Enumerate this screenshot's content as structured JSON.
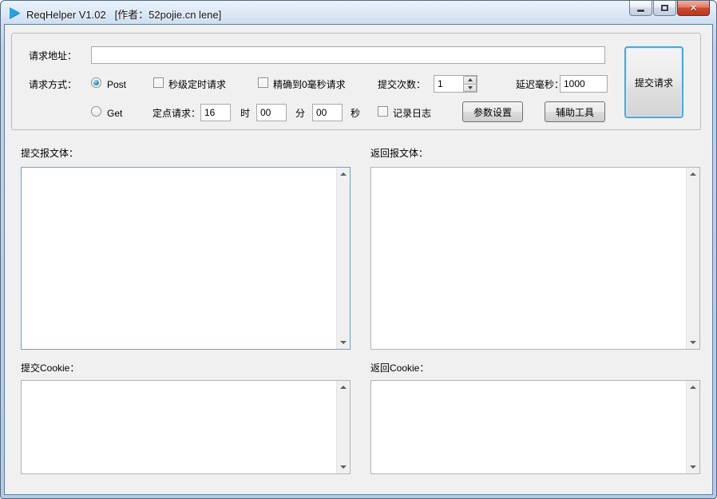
{
  "window": {
    "title": "ReqHelper V1.02   [作者：52pojie.cn lene]"
  },
  "form": {
    "url_label": "请求地址：",
    "url_value": "",
    "method_label": "请求方式：",
    "method_post": "Post",
    "method_get": "Get",
    "timed_checkbox": "秒级定时请求",
    "precise_checkbox": "精确到0毫秒请求",
    "fixed_request_label": "定点请求：",
    "hour_value": "16",
    "hour_unit": "时",
    "minute_value": "00",
    "minute_unit": "分",
    "second_value": "00",
    "second_unit": "秒",
    "submit_count_label": "提交次数：",
    "submit_count_value": "1",
    "delay_label": "延迟毫秒：",
    "delay_value": "1000",
    "log_checkbox": "记录日志",
    "params_button": "参数设置",
    "tools_button": "辅助工具",
    "submit_button": "提交请求"
  },
  "sections": {
    "request_body": "提交报文体：",
    "response_body": "返回报文体：",
    "request_cookie": "提交Cookie：",
    "response_cookie": "返回Cookie："
  },
  "colors": {
    "focus_border": "#44a8dc",
    "close_button": "#cc4a30",
    "client_background": "#f0f0f0"
  }
}
